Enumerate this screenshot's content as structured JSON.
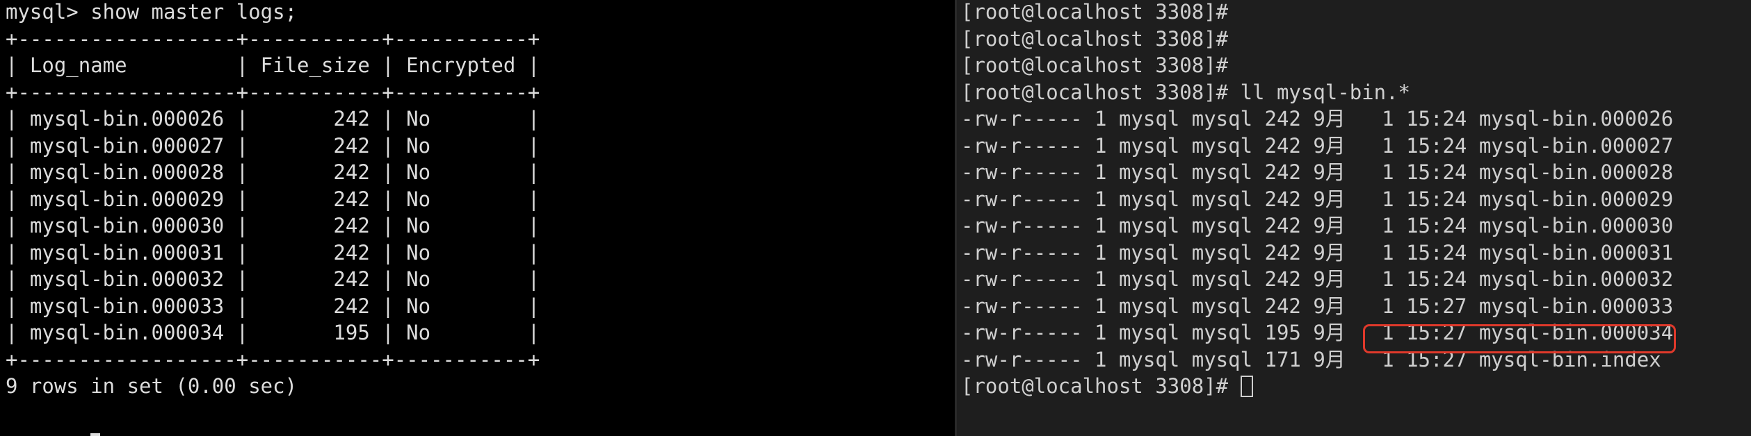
{
  "left_terminal": {
    "lines": [
      "mysql> show master logs;",
      "+------------------+-----------+-----------+",
      "| Log_name         | File_size | Encrypted |",
      "+------------------+-----------+-----------+",
      "| mysql-bin.000026 |       242 | No        |",
      "| mysql-bin.000027 |       242 | No        |",
      "| mysql-bin.000028 |       242 | No        |",
      "| mysql-bin.000029 |       242 | No        |",
      "| mysql-bin.000030 |       242 | No        |",
      "| mysql-bin.000031 |       242 | No        |",
      "| mysql-bin.000032 |       242 | No        |",
      "| mysql-bin.000033 |       242 | No        |",
      "| mysql-bin.000034 |       195 | No        |",
      "+------------------+-----------+-----------+",
      "9 rows in set (0.00 sec)"
    ]
  },
  "right_terminal": {
    "lines": [
      "[root@localhost 3308]#",
      "[root@localhost 3308]#",
      "[root@localhost 3308]#",
      "[root@localhost 3308]# ll mysql-bin.*",
      "-rw-r----- 1 mysql mysql 242 9月   1 15:24 mysql-bin.000026",
      "-rw-r----- 1 mysql mysql 242 9月   1 15:24 mysql-bin.000027",
      "-rw-r----- 1 mysql mysql 242 9月   1 15:24 mysql-bin.000028",
      "-rw-r----- 1 mysql mysql 242 9月   1 15:24 mysql-bin.000029",
      "-rw-r----- 1 mysql mysql 242 9月   1 15:24 mysql-bin.000030",
      "-rw-r----- 1 mysql mysql 242 9月   1 15:24 mysql-bin.000031",
      "-rw-r----- 1 mysql mysql 242 9月   1 15:24 mysql-bin.000032",
      "-rw-r----- 1 mysql mysql 242 9月   1 15:27 mysql-bin.000033",
      "-rw-r----- 1 mysql mysql 195 9月   1 15:27 mysql-bin.000034",
      "-rw-r----- 1 mysql mysql 171 9月   1 15:27 mysql-bin.index"
    ],
    "prompt": "[root@localhost 3308]# "
  },
  "colors": {
    "left_bg": "#000000",
    "right_bg": "#1e1e1e",
    "text": "#dcdcdc",
    "highlight": "#e0392b"
  }
}
